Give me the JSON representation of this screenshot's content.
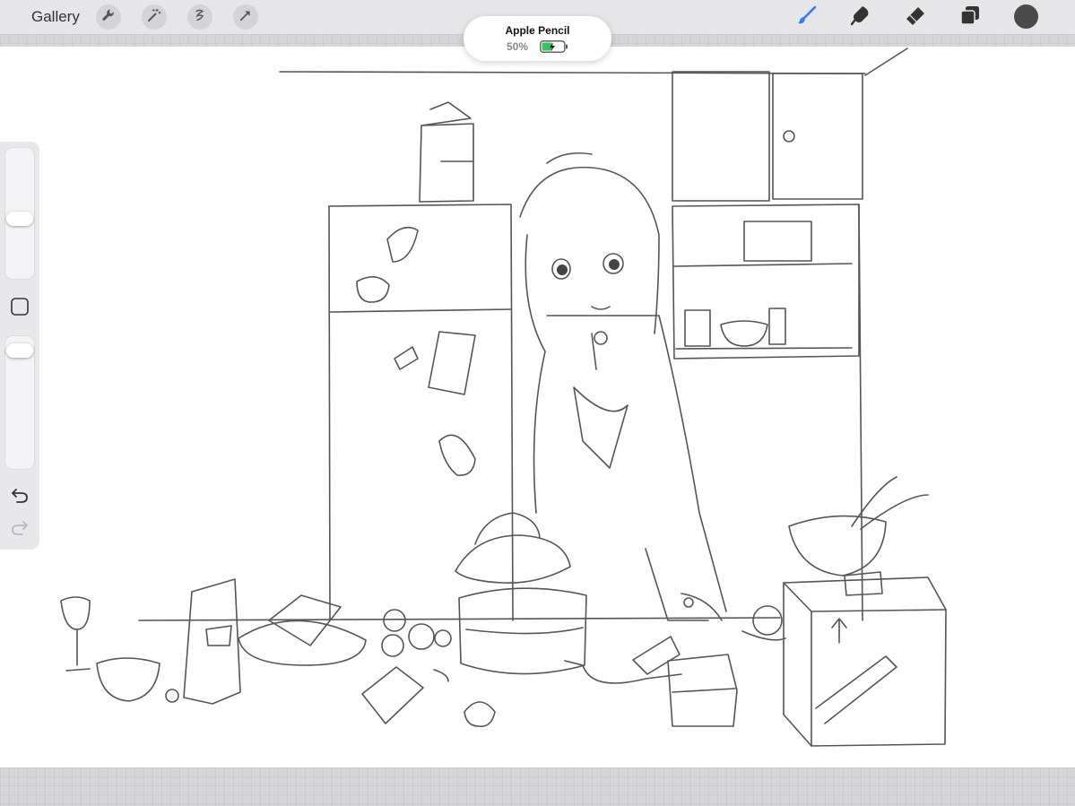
{
  "topbar": {
    "gallery_label": "Gallery",
    "left_tools": [
      {
        "name": "wrench-icon"
      },
      {
        "name": "magic-wand-icon"
      },
      {
        "name": "selection-icon"
      },
      {
        "name": "transform-arrow-icon"
      }
    ],
    "right_tools": [
      {
        "name": "brush-icon",
        "active": true
      },
      {
        "name": "smudge-icon"
      },
      {
        "name": "eraser-icon"
      },
      {
        "name": "layers-icon"
      }
    ],
    "color": "#4a4a4a"
  },
  "pencil_popup": {
    "device": "Apple Pencil",
    "battery": "50%",
    "battery_level": 0.5,
    "battery_color": "#34c759"
  },
  "sidebar": {
    "brush_size": 0.45,
    "opacity": 0.05,
    "modify_button": "square-icon",
    "undo": "undo-icon",
    "redo": "redo-icon"
  },
  "colors": {
    "accent": "#2f7cf6",
    "ink": "#555555"
  }
}
